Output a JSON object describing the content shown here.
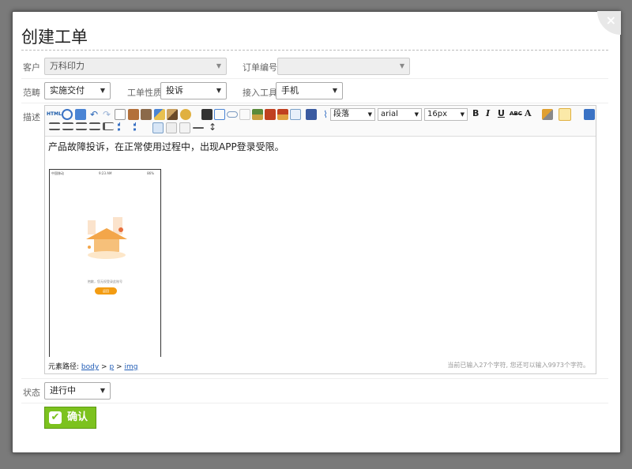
{
  "modal": {
    "title": "创建工单",
    "close_glyph": "×"
  },
  "form": {
    "customer": {
      "label": "客户",
      "value": "万科印力"
    },
    "order_no": {
      "label": "订单编号",
      "value": ""
    },
    "category": {
      "label": "范畴",
      "value": "实施交付"
    },
    "nature": {
      "label": "工单性质",
      "value": "投诉"
    },
    "channel": {
      "label": "接入工具",
      "value": "手机"
    },
    "description": {
      "label": "描述",
      "text": "产品故障投诉，在正常使用过程中，出现APP登录受限。",
      "toolbar": {
        "html_label": "HTML",
        "paragraph": "段落",
        "font": "arial",
        "size": "16px",
        "bold": "B",
        "italic": "I",
        "underline": "U",
        "strike": "ABC",
        "fontcolor": "A"
      },
      "path_label": "元素路径:",
      "path": [
        "body",
        "p",
        "img"
      ],
      "path_sep": " > ",
      "char_count": "当前已输入27个字符, 您还可以输入9973个字符。",
      "image": {
        "status_left": "中国移动",
        "status_time": "9:23 AM",
        "status_right": "86%",
        "message": "抱歉，您无权登录此账号",
        "button": "返回"
      }
    },
    "status": {
      "label": "状态",
      "value": "进行中"
    }
  },
  "confirm": {
    "label": "确认"
  }
}
